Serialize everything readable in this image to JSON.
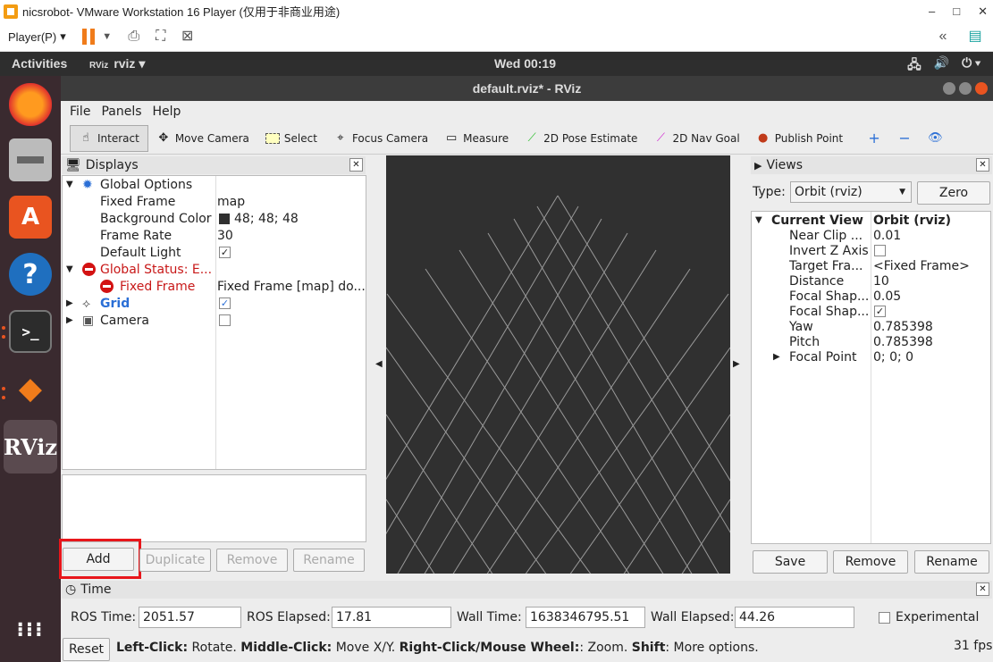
{
  "vm": {
    "title": "nicsrobot- VMware Workstation 16 Player (仅用于非商业用途)",
    "player_menu": "Player(P)",
    "min": "–",
    "max": "□",
    "close": "✕"
  },
  "gnome": {
    "activities": "Activities",
    "app": "rviz",
    "clock": "Wed 00:19"
  },
  "rviz": {
    "title": "default.rviz* - RViz",
    "menu": [
      "File",
      "Panels",
      "Help"
    ],
    "tools": [
      {
        "label": "Interact",
        "icon": "interact-icon"
      },
      {
        "label": "Move Camera",
        "icon": "move-camera-icon"
      },
      {
        "label": "Select",
        "icon": "select-icon"
      },
      {
        "label": "Focus Camera",
        "icon": "focus-camera-icon"
      },
      {
        "label": "Measure",
        "icon": "measure-icon"
      },
      {
        "label": "2D Pose Estimate",
        "icon": "pose-estimate-icon"
      },
      {
        "label": "2D Nav Goal",
        "icon": "nav-goal-icon"
      },
      {
        "label": "Publish Point",
        "icon": "publish-point-icon"
      }
    ],
    "displays": {
      "title": "Displays",
      "rows": [
        {
          "name": "Global Options",
          "value": ""
        },
        {
          "name": "Fixed Frame",
          "value": "map"
        },
        {
          "name": "Background Color",
          "value": "48; 48; 48"
        },
        {
          "name": "Frame Rate",
          "value": "30"
        },
        {
          "name": "Default Light",
          "value": "✓"
        },
        {
          "name": "Global Status: E...",
          "value": ""
        },
        {
          "name": "Fixed Frame",
          "value": "Fixed Frame [map] do..."
        },
        {
          "name": "Grid",
          "value": "✓"
        },
        {
          "name": "Camera",
          "value": ""
        }
      ],
      "buttons": [
        "Add",
        "Duplicate",
        "Remove",
        "Rename"
      ]
    },
    "views": {
      "title": "Views",
      "type_label": "Type:",
      "type_value": "Orbit (rviz)",
      "zero": "Zero",
      "rows": [
        {
          "name": "Current View",
          "value": "Orbit (rviz)"
        },
        {
          "name": "Near Clip ...",
          "value": "0.01"
        },
        {
          "name": "Invert Z Axis",
          "value": ""
        },
        {
          "name": "Target Fra...",
          "value": "<Fixed Frame>"
        },
        {
          "name": "Distance",
          "value": "10"
        },
        {
          "name": "Focal Shap...",
          "value": "0.05"
        },
        {
          "name": "Focal Shap...",
          "value": "✓"
        },
        {
          "name": "Yaw",
          "value": "0.785398"
        },
        {
          "name": "Pitch",
          "value": "0.785398"
        },
        {
          "name": "Focal Point",
          "value": "0; 0; 0"
        }
      ],
      "buttons": [
        "Save",
        "Remove",
        "Rename"
      ]
    },
    "time": {
      "title": "Time",
      "ros_time_label": "ROS Time:",
      "ros_time": "2051.57",
      "ros_elapsed_label": "ROS Elapsed:",
      "ros_elapsed": "17.81",
      "wall_time_label": "Wall Time:",
      "wall_time": "1638346795.51",
      "wall_elapsed_label": "Wall Elapsed:",
      "wall_elapsed": "44.26",
      "experimental": "Experimental"
    },
    "status": {
      "reset": "Reset",
      "k1": "Left-Click:",
      "t1": " Rotate. ",
      "k2": "Middle-Click:",
      "t2": " Move X/Y. ",
      "k3": "Right-Click/Mouse Wheel:",
      "t3": ": Zoom. ",
      "k4": "Shift",
      "t4": ": More options.",
      "fps": "31 fps"
    }
  }
}
